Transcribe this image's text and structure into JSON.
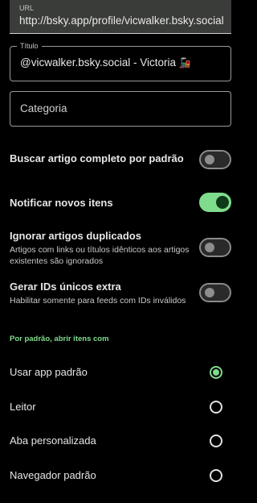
{
  "url_field": {
    "label": "URL",
    "value": "http://bsky.app/profile/vicwalker.bsky.social"
  },
  "title_field": {
    "label": "Título",
    "value": "@vicwalker.bsky.social - Victoria",
    "emoji": "🚂"
  },
  "category_field": {
    "placeholder": "Categoria"
  },
  "toggles": [
    {
      "title": "Buscar artigo completo por padrão",
      "subtitle": "",
      "on": false
    },
    {
      "title": "Notificar novos itens",
      "subtitle": "",
      "on": true
    },
    {
      "title": "Ignorar artigos duplicados",
      "subtitle": "Artigos com links ou títulos idênticos aos artigos existentes são ignorados",
      "on": false
    },
    {
      "title": "Gerar IDs únicos extra",
      "subtitle": "Habilitar somente para feeds com IDs inválidos",
      "on": false
    }
  ],
  "open_items": {
    "header": "Por padrão, abrir itens com",
    "options": [
      {
        "label": "Usar app padrão",
        "selected": true
      },
      {
        "label": "Leitor",
        "selected": false
      },
      {
        "label": "Aba personalizada",
        "selected": false
      },
      {
        "label": "Navegador padrão",
        "selected": false
      }
    ]
  },
  "colors": {
    "accent": "#7fdc8c",
    "background": "#000000",
    "field_fill": "#3a3c39"
  }
}
